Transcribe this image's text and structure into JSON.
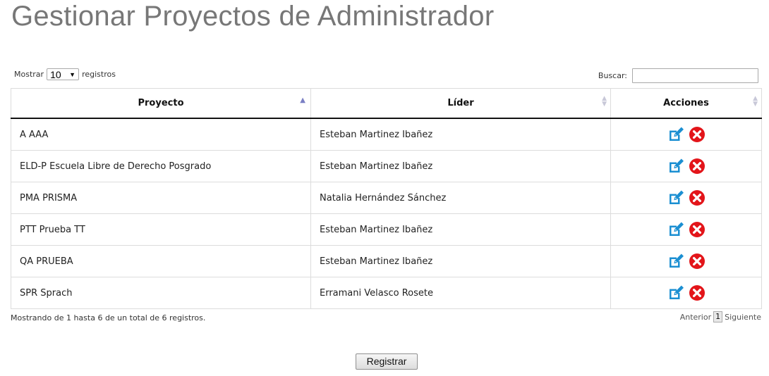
{
  "page": {
    "title": "Gestionar Proyectos de Administrador"
  },
  "controls": {
    "length_prefix": "Mostrar",
    "length_value": "10",
    "length_suffix": "registros",
    "search_label": "Buscar:",
    "search_value": ""
  },
  "table": {
    "headers": [
      "Proyecto",
      "Líder",
      "Acciones"
    ],
    "rows": [
      {
        "proyecto": "A AAA",
        "lider": "Esteban Martinez Ibañez"
      },
      {
        "proyecto": "ELD-P Escuela Libre de Derecho Posgrado",
        "lider": "Esteban Martinez Ibañez"
      },
      {
        "proyecto": "PMA PRISMA",
        "lider": "Natalia Hernández Sánchez"
      },
      {
        "proyecto": "PTT Prueba TT",
        "lider": "Esteban Martinez Ibañez"
      },
      {
        "proyecto": "QA PRUEBA",
        "lider": "Esteban Martinez Ibañez"
      },
      {
        "proyecto": "SPR Sprach",
        "lider": "Erramani Velasco Rosete"
      }
    ]
  },
  "footer": {
    "info": "Mostrando de 1 hasta 6 de un total de 6 registros.",
    "prev_label": "Anterior",
    "current_page": "1",
    "next_label": "Siguiente"
  },
  "actions": {
    "register_label": "Registrar"
  },
  "icons": {
    "edit": "edit-icon",
    "delete": "delete-icon"
  },
  "colors": {
    "edit": "#1b8fd2",
    "delete": "#e3151a",
    "title": "#777777"
  }
}
